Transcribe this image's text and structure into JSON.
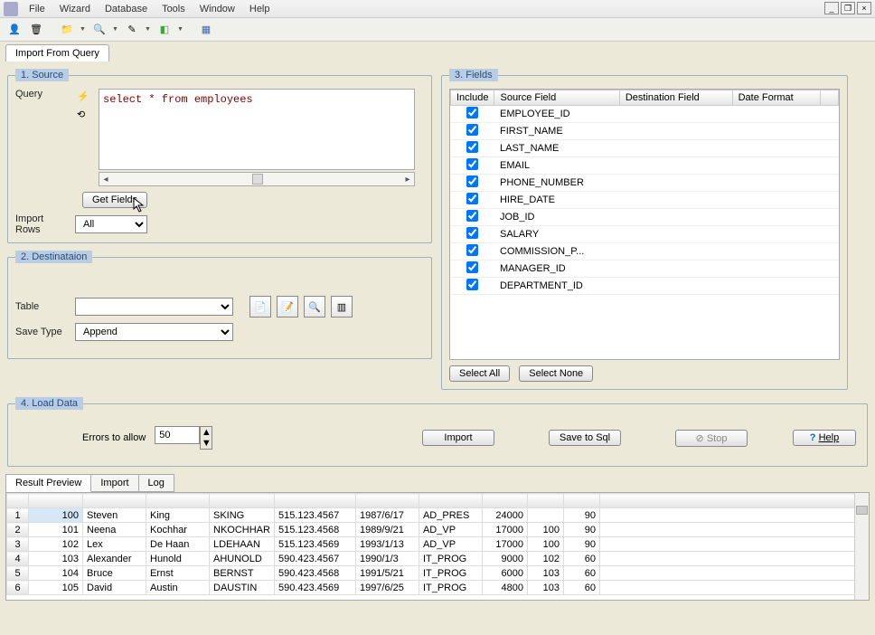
{
  "menus": [
    "File",
    "Wizard",
    "Database",
    "Tools",
    "Window",
    "Help"
  ],
  "tab_title": "Import From Query",
  "source": {
    "legend": "1. Source",
    "query_label": "Query",
    "query_text": "select * from employees",
    "get_fields": "Get Fields",
    "import_rows_label": "Import Rows",
    "import_rows_value": "All"
  },
  "destination": {
    "legend": "2. Destinataion",
    "table_label": "Table",
    "table_value": "",
    "save_type_label": "Save Type",
    "save_type_value": "Append"
  },
  "fields": {
    "legend": "3. Fields",
    "cols": [
      "Include",
      "Source Field",
      "Destination Field",
      "Date Format"
    ],
    "rows": [
      "EMPLOYEE_ID",
      "FIRST_NAME",
      "LAST_NAME",
      "EMAIL",
      "PHONE_NUMBER",
      "HIRE_DATE",
      "JOB_ID",
      "SALARY",
      "COMMISSION_P...",
      "MANAGER_ID",
      "DEPARTMENT_ID"
    ],
    "select_all": "Select All",
    "select_none": "Select None"
  },
  "load": {
    "legend": "4. Load Data",
    "errors_label": "Errors to allow",
    "errors_value": "50",
    "import_btn": "Import",
    "save_sql_btn": "Save to Sql",
    "stop_btn": "Stop",
    "help_btn": "Help"
  },
  "bottom_tabs": [
    "Result Preview",
    "Import",
    "Log"
  ],
  "grid": {
    "rows": [
      [
        "100",
        "Steven",
        "King",
        "SKING",
        "515.123.4567",
        "1987/6/17",
        "AD_PRES",
        "24000",
        "",
        "90"
      ],
      [
        "101",
        "Neena",
        "Kochhar",
        "NKOCHHAR",
        "515.123.4568",
        "1989/9/21",
        "AD_VP",
        "17000",
        "100",
        "90"
      ],
      [
        "102",
        "Lex",
        "De Haan",
        "LDEHAAN",
        "515.123.4569",
        "1993/1/13",
        "AD_VP",
        "17000",
        "100",
        "90"
      ],
      [
        "103",
        "Alexander",
        "Hunold",
        "AHUNOLD",
        "590.423.4567",
        "1990/1/3",
        "IT_PROG",
        "9000",
        "102",
        "60"
      ],
      [
        "104",
        "Bruce",
        "Ernst",
        "BERNST",
        "590.423.4568",
        "1991/5/21",
        "IT_PROG",
        "6000",
        "103",
        "60"
      ],
      [
        "105",
        "David",
        "Austin",
        "DAUSTIN",
        "590.423.4569",
        "1997/6/25",
        "IT_PROG",
        "4800",
        "103",
        "60"
      ]
    ]
  }
}
